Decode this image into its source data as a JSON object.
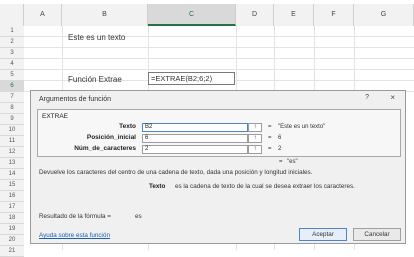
{
  "spreadsheet": {
    "columns": [
      "A",
      "B",
      "C",
      "D",
      "E",
      "F",
      "G"
    ],
    "selected_column": "C",
    "rows": [
      "1",
      "2",
      "3",
      "4",
      "5",
      "6",
      "7",
      "8",
      "9",
      "10",
      "11",
      "12",
      "13",
      "14",
      "15",
      "16",
      "17",
      "18",
      "19",
      "20",
      "21"
    ],
    "selected_row": "6",
    "cells": {
      "B2": "Este es un texto",
      "B6": "Función Extrae",
      "C6": "=EXTRAE(B2;6;2)"
    }
  },
  "dialog": {
    "title": "Argumentos de función",
    "help_symbol": "?",
    "close_symbol": "×",
    "function_name": "EXTRAE",
    "arguments": [
      {
        "label": "Texto",
        "value": "B2",
        "collapse_symbol": "↑",
        "equals": "=",
        "result": "\"Este es un texto\""
      },
      {
        "label": "Posición_inicial",
        "value": "6",
        "collapse_symbol": "↑",
        "equals": "=",
        "result": "6"
      },
      {
        "label": "Núm_de_caracteres",
        "value": "2",
        "collapse_symbol": "↑",
        "equals": "=",
        "result": "2"
      }
    ],
    "summary_equals": "=",
    "summary_result": "\"es\"",
    "description": "Devuelve los caracteres del centro de una cadena de texto, dada una posición y longitud iniciales.",
    "arg_description_name": "Texto",
    "arg_description": "es la cadena de texto de la cual se desea extraer los caracteres.",
    "formula_result_label": "Resultado de la fórmula =",
    "formula_result_value": "es",
    "help_link": "Ayuda sobre esta función",
    "ok_label": "Aceptar",
    "cancel_label": "Cancelar"
  },
  "colors": {
    "accent": "#217346",
    "link": "#1a5fb4",
    "focus": "#4a86c8"
  }
}
